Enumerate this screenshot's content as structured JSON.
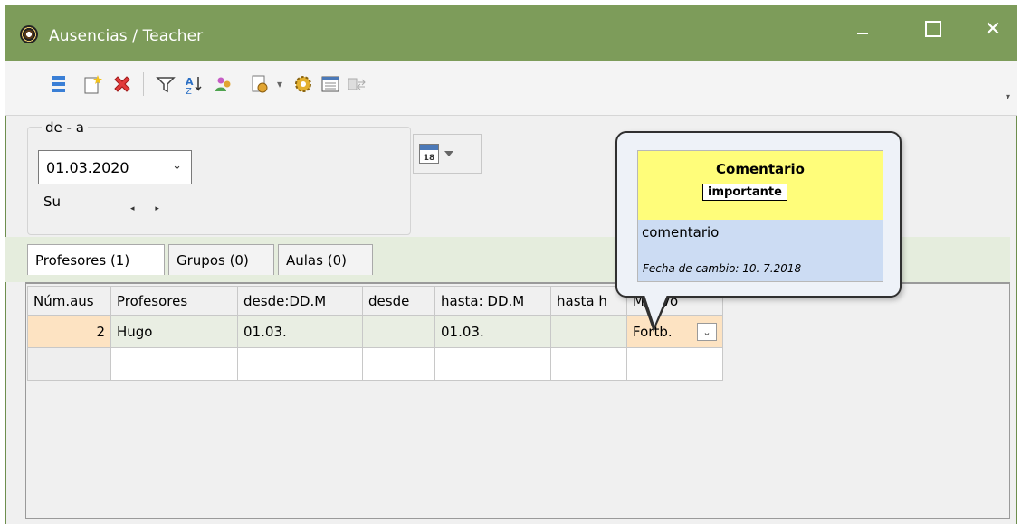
{
  "window": {
    "title": "Ausencias / Teacher",
    "close_glyph": "✕"
  },
  "toolbar": {
    "icons": [
      "list-icon",
      "new-icon",
      "delete-icon",
      "filter-icon",
      "sort-icon",
      "users-icon",
      "report-icon",
      "settings-icon",
      "calendar-list-icon",
      "exchange-icon"
    ],
    "dropdown_glyph": "▾"
  },
  "date_filter": {
    "legend": "de - a",
    "value": "01.03.2020",
    "day": "Su",
    "nav": "◂ ▸"
  },
  "calendar_button": {
    "day_number": "18"
  },
  "tabs": [
    {
      "label": "Profesores (1)"
    },
    {
      "label": "Grupos (0)"
    },
    {
      "label": "Aulas (0)"
    }
  ],
  "grid": {
    "columns": [
      "Núm.aus",
      "Profesores",
      "desde:DD.M",
      "desde",
      "hasta: DD.M",
      "hasta h",
      "Motivo"
    ],
    "rows": [
      {
        "num": "2",
        "profesor": "Hugo",
        "desde_fecha": "01.03.",
        "desde_hora": "",
        "hasta_fecha": "01.03.",
        "hasta_hora": "",
        "motivo": "Fortb."
      }
    ]
  },
  "tooltip": {
    "title": "Comentario",
    "badge": "importante",
    "comment": "comentario",
    "change_date": "Fecha de cambio: 10. 7.2018"
  },
  "colors": {
    "titlebar": "#7d9c5a",
    "tooltip_yellow": "#fffd7a",
    "tooltip_blue": "#ccdcf3",
    "highlight_cell": "#fde3c2"
  }
}
